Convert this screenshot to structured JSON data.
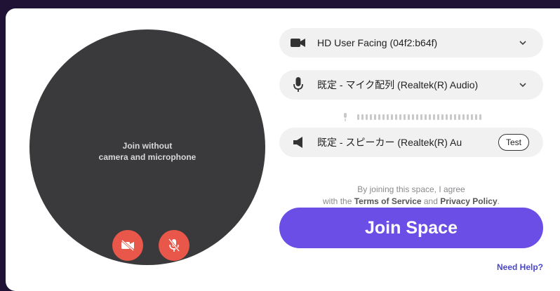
{
  "preview": {
    "line1": "Join without",
    "line2": "camera and microphone"
  },
  "devices": {
    "camera": "HD User Facing (04f2:b64f)",
    "microphone": "既定 - マイク配列 (Realtek(R) Audio)",
    "speaker": "既定 - スピーカー (Realtek(R) Au",
    "test_label": "Test"
  },
  "terms": {
    "line1": "By joining this space, I agree",
    "prefix": "with the ",
    "tos": "Terms of Service",
    "and": " and ",
    "privacy": "Privacy Policy",
    "suffix": "."
  },
  "join_label": "Join Space",
  "help_label": "Need Help?",
  "icons": [
    "camera-icon",
    "microphone-icon",
    "speaker-icon",
    "chevron-down-icon",
    "camera-off-icon",
    "mic-off-icon",
    "mic-level-icon"
  ],
  "colors": {
    "accent": "#6a4ee6",
    "danger": "#e9574a",
    "preview_bg": "#3a3a3c"
  }
}
